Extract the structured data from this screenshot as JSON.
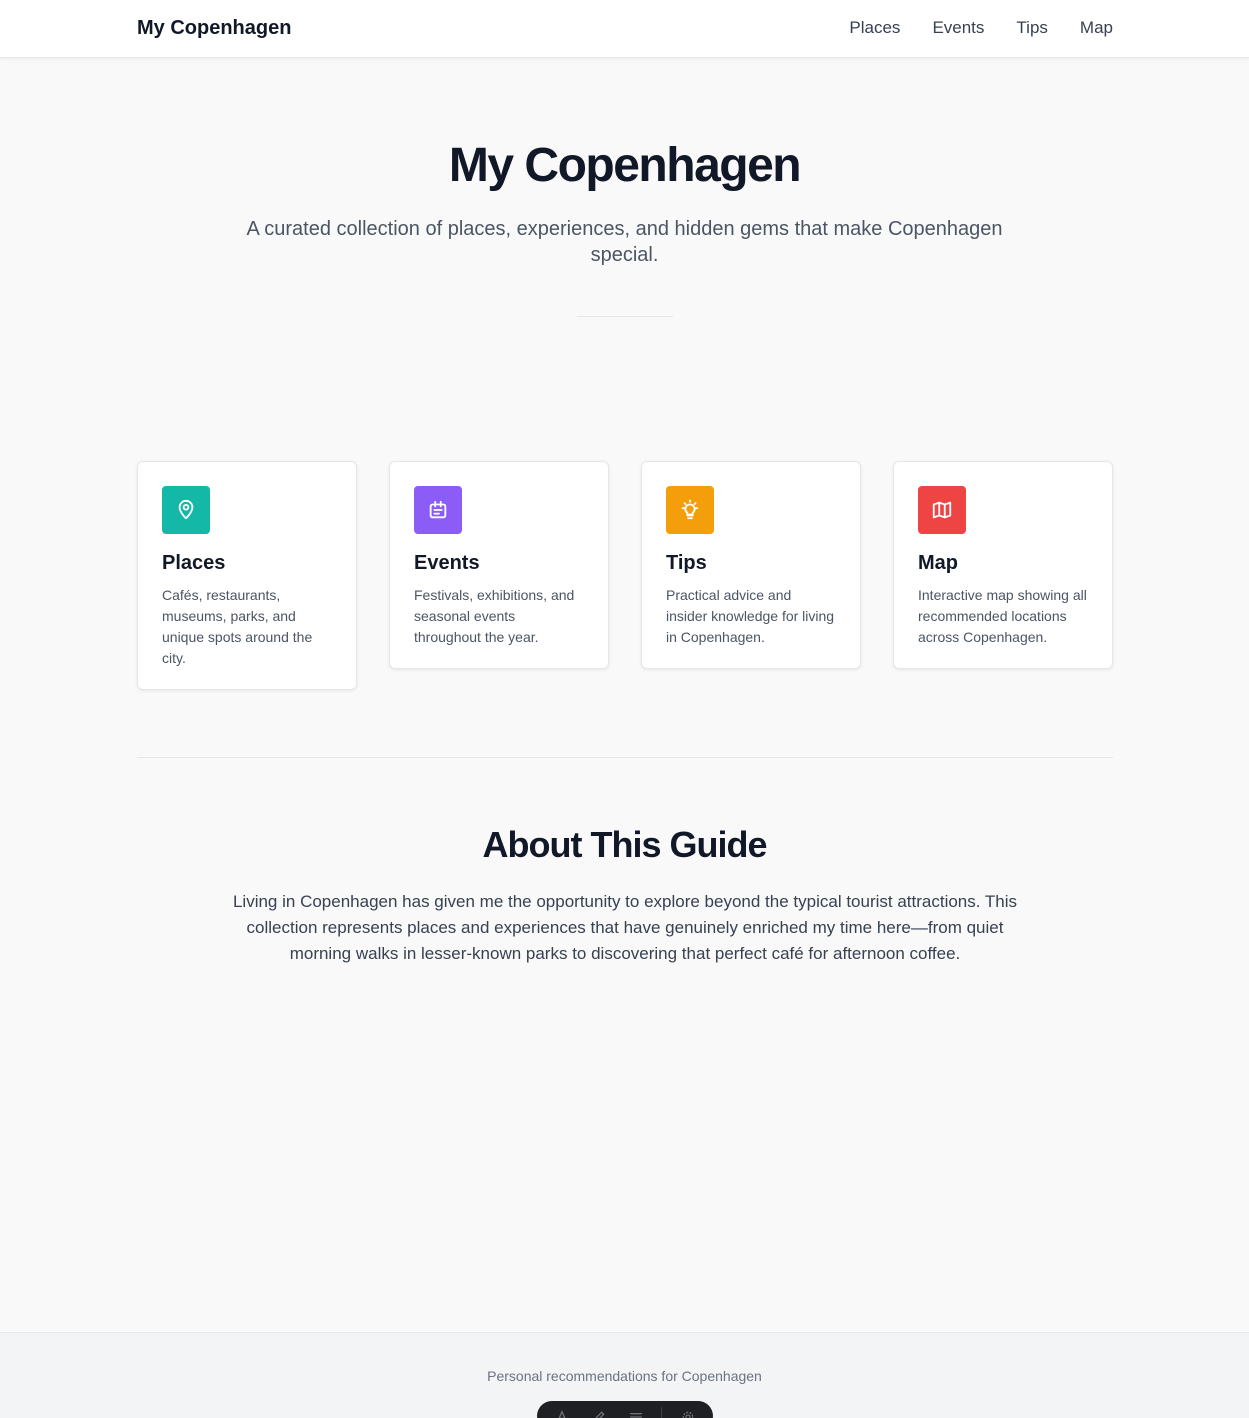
{
  "header": {
    "brand": "My Copenhagen",
    "nav": [
      "Places",
      "Events",
      "Tips",
      "Map"
    ]
  },
  "hero": {
    "title": "My Copenhagen",
    "subtitle": "A curated collection of places, experiences, and hidden gems that make Copenhagen special."
  },
  "cards": [
    {
      "title": "Places",
      "description": "Cafés, restaurants, museums, parks, and unique spots around the city.",
      "icon": "map-pin-icon",
      "color": "#14b8a6"
    },
    {
      "title": "Events",
      "description": "Festivals, exhibitions, and seasonal events throughout the year.",
      "icon": "calendar-icon",
      "color": "#8b5cf6"
    },
    {
      "title": "Tips",
      "description": "Practical advice and insider knowledge for living in Copenhagen.",
      "icon": "lightbulb-icon",
      "color": "#f59e0b"
    },
    {
      "title": "Map",
      "description": "Interactive map showing all recommended locations across Copenhagen.",
      "icon": "map-icon",
      "color": "#ef4444"
    }
  ],
  "about": {
    "title": "About This Guide",
    "text": "Living in Copenhagen has given me the opportunity to explore beyond the typical tourist attractions. This collection represents places and experiences that have genuinely enriched my time here—from quiet morning walks in lesser-known parks to discovering that perfect café for afternoon coffee."
  },
  "footer": {
    "text": "Personal recommendations for Copenhagen",
    "toolbar_icons": [
      "text-icon",
      "pen-icon",
      "menu-icon",
      "settings-icon"
    ]
  }
}
